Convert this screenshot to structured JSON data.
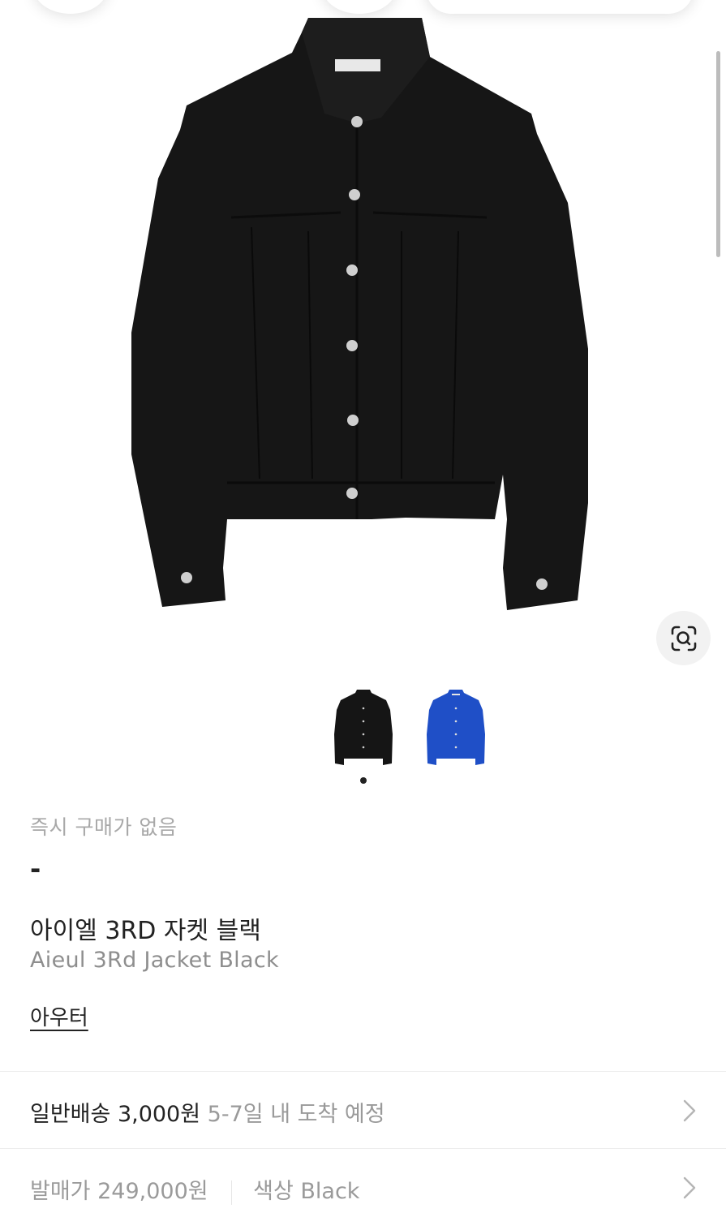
{
  "product": {
    "instant_label": "즉시 구매가 없음",
    "instant_price": "-",
    "title_ko": "아이엘 3RD 자켓 블랙",
    "title_en": "Aieul 3Rd Jacket Black",
    "category": "아우터"
  },
  "images": {
    "main_color": "#151515",
    "variant_colors": [
      "#151515",
      "#1f4fc7"
    ]
  },
  "shipping": {
    "type_fee": "일반배송 3,000원",
    "eta": "5-7일 내 도착 예정"
  },
  "price_row": {
    "release_price": "발매가 249,000원",
    "color_label": "색상 Black"
  }
}
